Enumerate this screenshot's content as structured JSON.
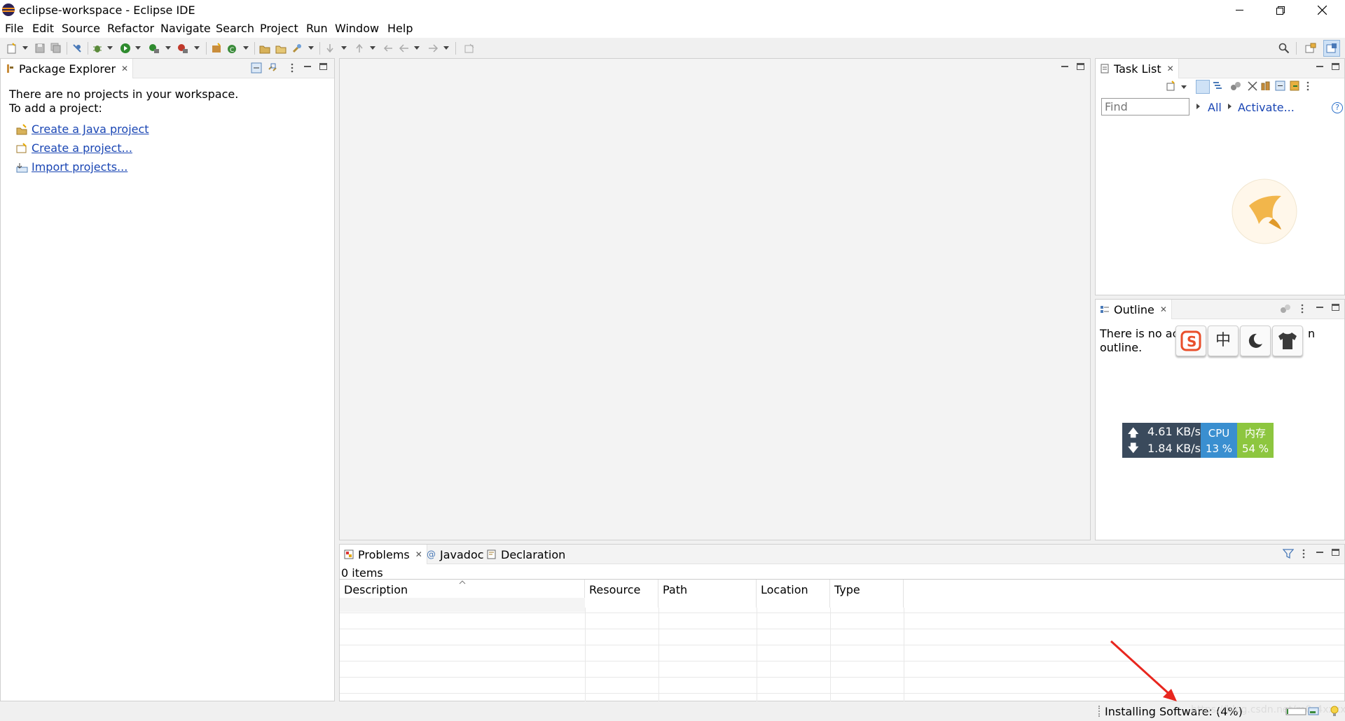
{
  "window": {
    "title": "eclipse-workspace - Eclipse IDE",
    "minimize_label": "—",
    "restore_label": "❐",
    "close_label": "✕"
  },
  "menu": [
    "File",
    "Edit",
    "Source",
    "Refactor",
    "Navigate",
    "Search",
    "Project",
    "Run",
    "Window",
    "Help"
  ],
  "package_explorer": {
    "tab_label": "Package Explorer",
    "message_line1": "There are no projects in your workspace.",
    "message_line2": "To add a project:",
    "links": [
      "Create a Java project",
      "Create a project...",
      "Import projects..."
    ]
  },
  "task_list": {
    "tab_label": "Task List",
    "find_placeholder": "Find",
    "all_label": "All",
    "activate_label": "Activate...",
    "help_label": "?"
  },
  "outline": {
    "tab_label": "Outline",
    "message_line1_visible": "There is no acti",
    "message_line1_tail": "n",
    "message_line2": "outline."
  },
  "ime_toolbar": {
    "buttons": [
      "sogou-s",
      "中",
      "moon",
      "shirt"
    ]
  },
  "net_monitor": {
    "upload": "4.61 KB/s",
    "download": "1.84 KB/s",
    "cpu_label": "CPU",
    "cpu_value": "13 %",
    "mem_label": "内存",
    "mem_value": "54 %"
  },
  "bottom_panel": {
    "tabs": [
      "Problems",
      "Javadoc",
      "Declaration"
    ],
    "items_count": "0 items",
    "columns": [
      "Description",
      "Resource",
      "Path",
      "Location",
      "Type"
    ]
  },
  "status": {
    "text": "Installing Software: (4%)",
    "watermark": "https://blog.csdn.net/m0_4xxxxxx"
  },
  "colors": {
    "accent_link": "#1a46b4",
    "net_bg": "#3a4a5c",
    "cpu_bg": "#3a8fd0",
    "mem_bg": "#8dc63f",
    "arrow": "#e8261e"
  }
}
